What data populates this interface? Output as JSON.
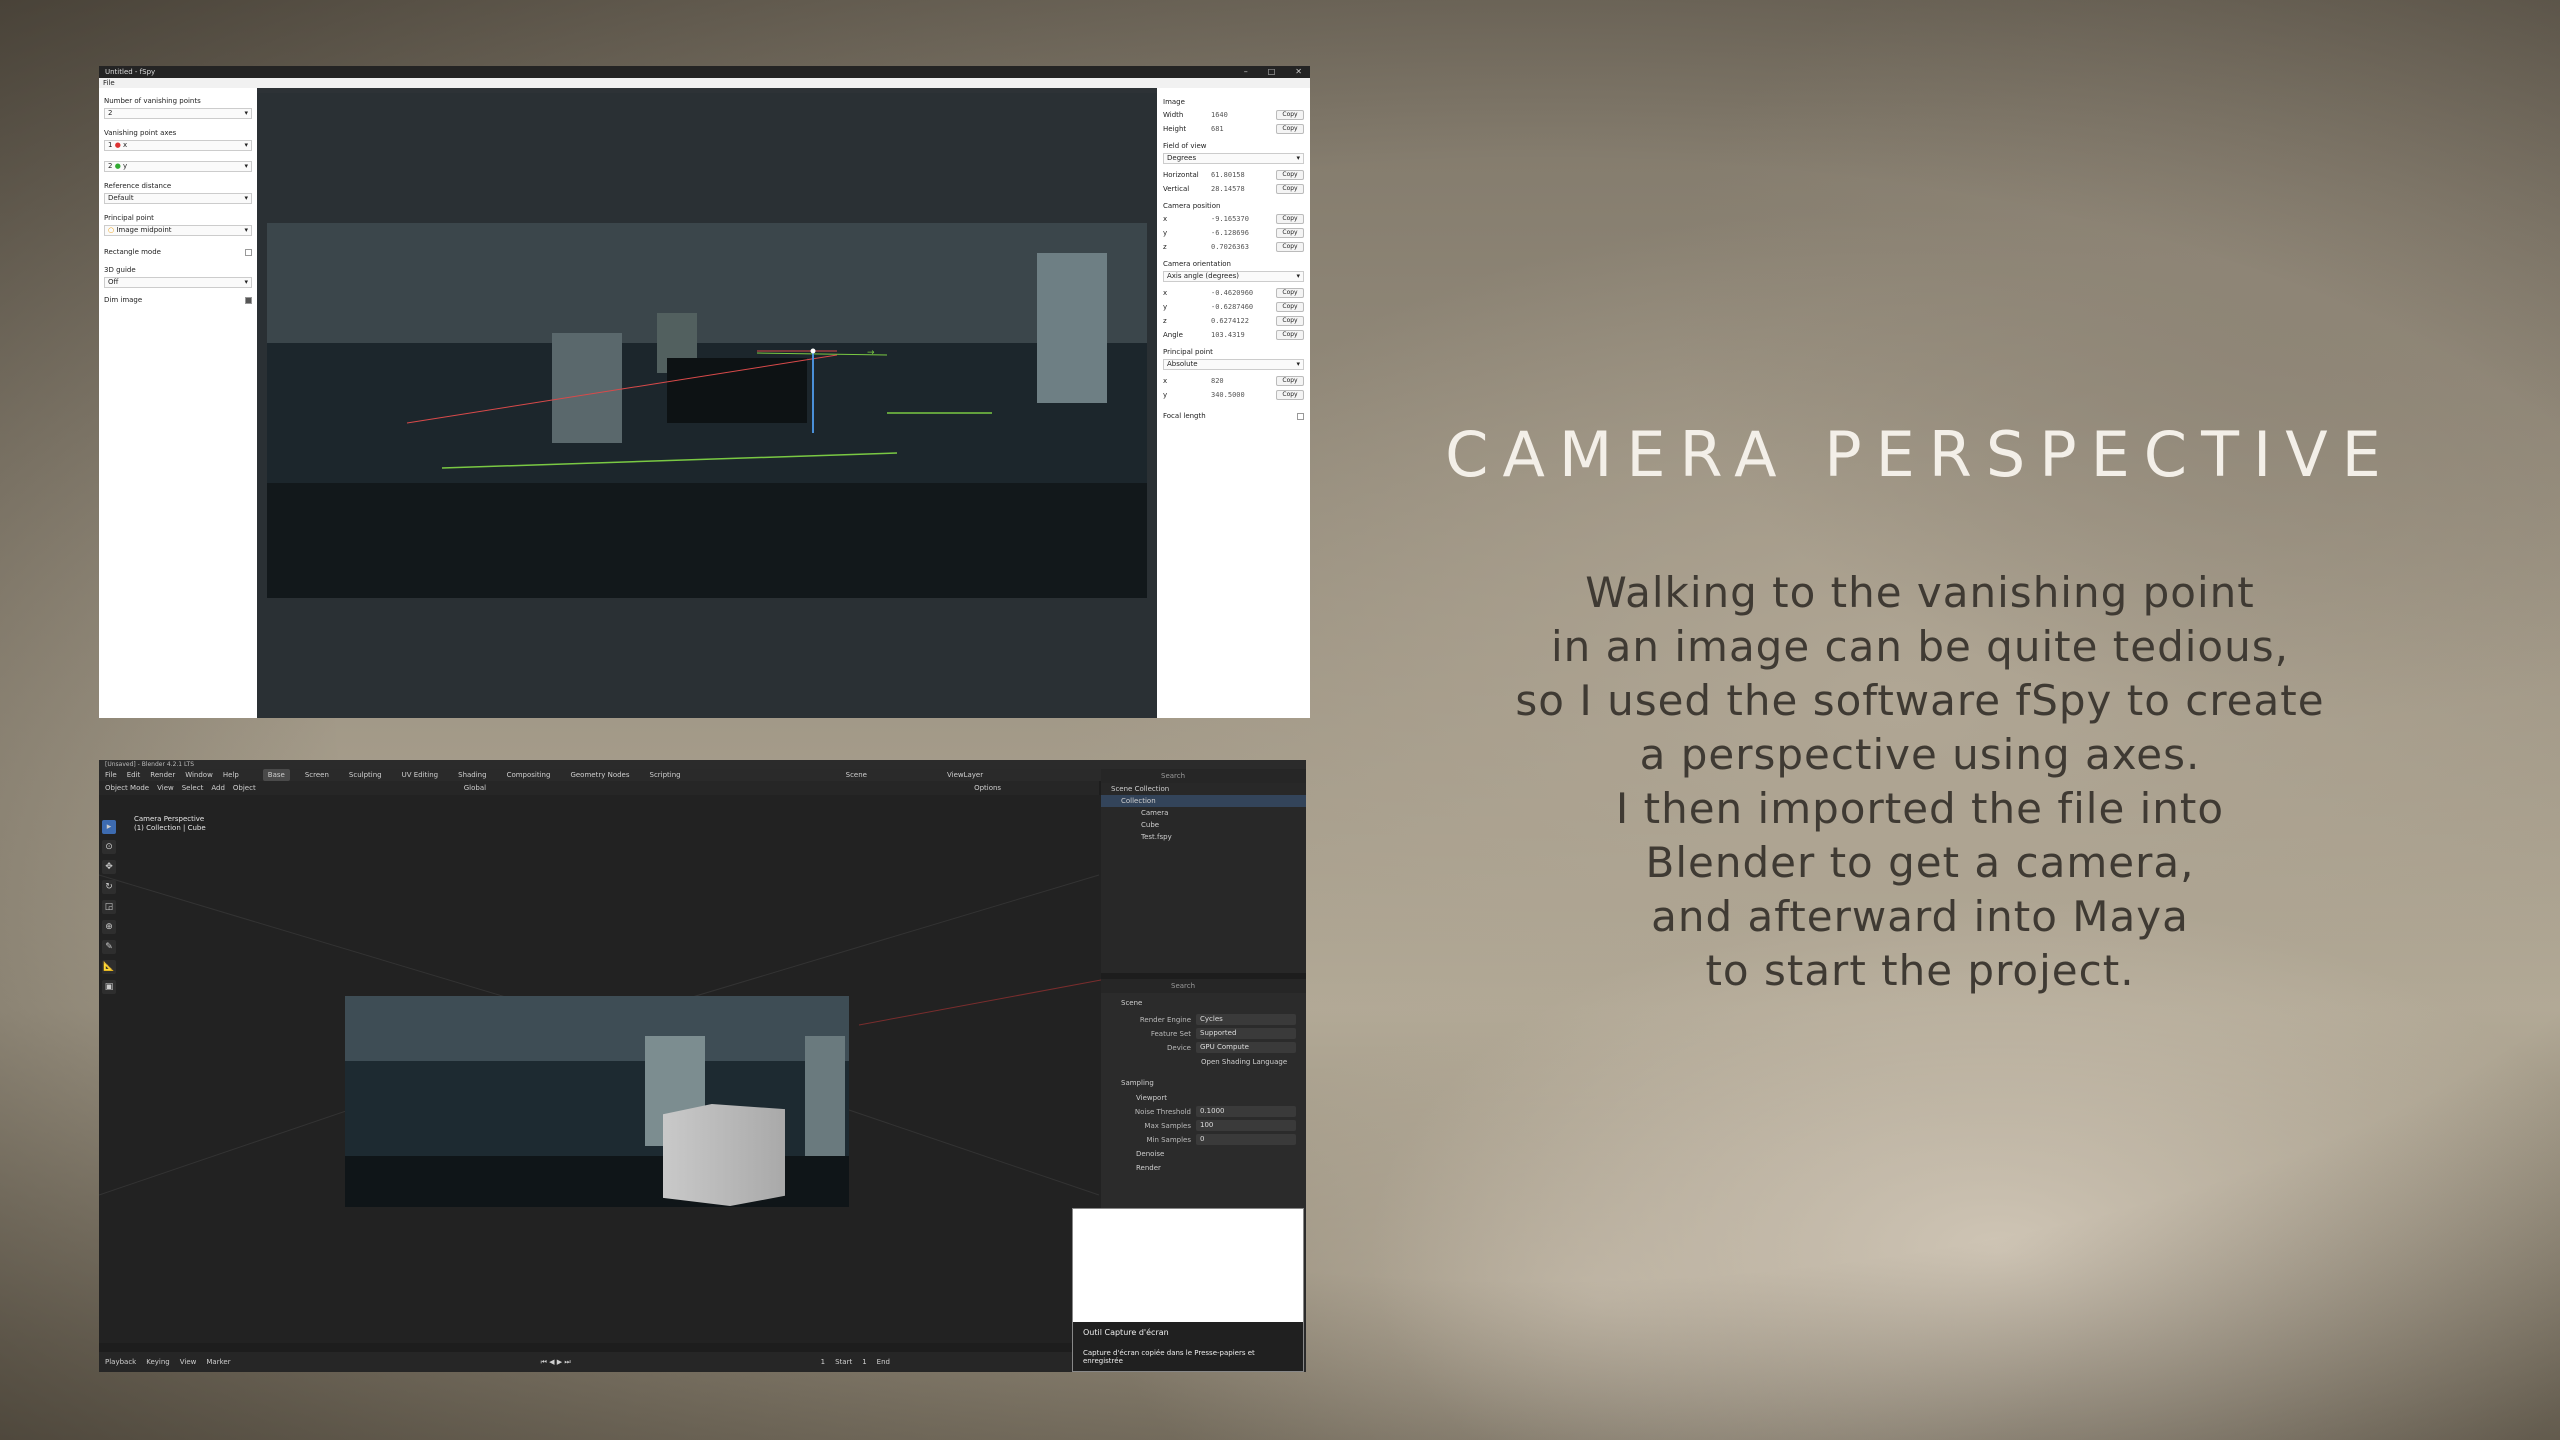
{
  "slide": {
    "title": "CAMERA PERSPECTIVE",
    "lines": [
      "Walking to the vanishing point",
      "in an image can be quite tedious,",
      "so I used the software fSpy to create",
      "a perspective using axes.",
      "I then imported the file into",
      "Blender to get a camera,",
      "and afterward into Maya",
      "to start the project."
    ]
  },
  "fspy": {
    "window_title": "Untitled - fSpy",
    "menu": "File",
    "left": {
      "vp_count_label": "Number of vanishing points",
      "vp_count": "2",
      "axes_label": "Vanishing point axes",
      "axis1_num": "1",
      "axis1": "x",
      "axis2_num": "2",
      "axis2": "y",
      "ref_label": "Reference distance",
      "ref": "Default",
      "pp_label": "Principal point",
      "pp": "Image midpoint",
      "rect_label": "Rectangle mode",
      "guide_label": "3D guide",
      "guide": "Off",
      "dim_label": "Dim image"
    },
    "right": {
      "image_label": "Image",
      "width_k": "Width",
      "width_v": "1640",
      "height_k": "Height",
      "height_v": "681",
      "fov_label": "Field of view",
      "fov_unit": "Degrees",
      "hfov_k": "Horizontal",
      "hfov_v": "61.80158",
      "vfov_k": "Vertical",
      "vfov_v": "28.14578",
      "campos_label": "Camera position",
      "px_k": "x",
      "px_v": "-9.165370",
      "py_k": "y",
      "py_v": "-6.128696",
      "pz_k": "z",
      "pz_v": "0.7026363",
      "orient_label": "Camera orientation",
      "orient_mode": "Axis angle (degrees)",
      "ox_k": "x",
      "ox_v": "-0.4620960",
      "oy_k": "y",
      "oy_v": "-0.6287460",
      "oz_k": "z",
      "oz_v": "0.6274122",
      "angle_k": "Angle",
      "angle_v": "103.4319",
      "pp_label": "Principal point",
      "pp_mode": "Absolute",
      "ppx_k": "x",
      "ppx_v": "820",
      "ppy_k": "y",
      "ppy_v": "340.5000",
      "focal_label": "Focal length",
      "copy": "Copy"
    }
  },
  "blender": {
    "window_title": "[Unsaved] - Blender 4.2.1 LTS",
    "menu": [
      "File",
      "Edit",
      "Render",
      "Window",
      "Help"
    ],
    "workspaces": [
      "Base",
      "Screen",
      "Sculpting",
      "UV Editing",
      "Shading",
      "Compositing",
      "Geometry Nodes",
      "Scripting"
    ],
    "header": [
      "Object Mode",
      "View",
      "Select",
      "Add",
      "Object",
      "Global",
      "Options"
    ],
    "viewport_info": [
      "Camera Perspective",
      "(1) Collection | Cube"
    ],
    "scene": "Scene",
    "view_layer": "ViewLayer",
    "search": "Search",
    "outliner": [
      "Scene Collection",
      "Collection",
      "Camera",
      "Cube",
      "Test.fspy"
    ],
    "props": {
      "scene": "Scene",
      "engine_k": "Render Engine",
      "engine_v": "Cycles",
      "feature_k": "Feature Set",
      "feature_v": "Supported",
      "device_k": "Device",
      "device_v": "GPU Compute",
      "osl": "Open Shading Language",
      "sampling": "Sampling",
      "viewport": "Viewport",
      "noise_k": "Noise Threshold",
      "noise_v": "0.1000",
      "max_k": "Max Samples",
      "max_v": "100",
      "min_k": "Min Samples",
      "min_v": "0",
      "denoise": "Denoise",
      "render": "Render"
    },
    "status": [
      "Playback",
      "Keying",
      "View",
      "Marker"
    ],
    "frame": "1",
    "start_k": "Start",
    "start_v": "1",
    "end_k": "End"
  },
  "notification": {
    "title": "Outil Capture d'écran",
    "text": "Capture d'écran copiée dans le Presse-papiers et enregistrée"
  }
}
